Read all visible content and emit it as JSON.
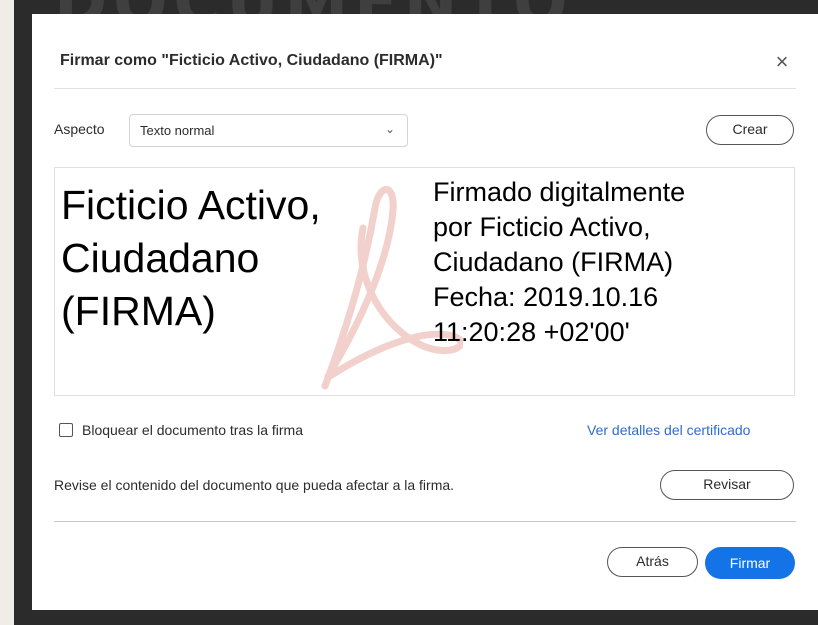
{
  "dialog": {
    "title": "Firmar como \"Ficticio Activo, Ciudadano (FIRMA)\"",
    "close_icon": "close-icon"
  },
  "appearance": {
    "label": "Aspecto",
    "selected": "Texto normal",
    "dropdown_icon": "chevron-down-icon",
    "create_label": "Crear"
  },
  "preview": {
    "name": "Ficticio Activo,\nCiudadano\n(FIRMA)",
    "details": "Firmado digitalmente\npor Ficticio Activo,\nCiudadano (FIRMA)\nFecha: 2019.10.16\n11:20:28 +02'00'",
    "watermark_icon": "acrobat-logo-icon",
    "watermark_color": "#e8a9a3"
  },
  "options": {
    "lock_label": "Bloquear el documento tras la firma",
    "lock_checked": false,
    "cert_link": "Ver detalles del certificado"
  },
  "review": {
    "text": "Revise el contenido del documento que pueda afectar a la firma.",
    "button_label": "Revisar"
  },
  "footer": {
    "back_label": "Atrás",
    "sign_label": "Firmar"
  },
  "colors": {
    "primary": "#1473e6",
    "link": "#2d6ccf",
    "backdrop": "#2b2b2b"
  }
}
